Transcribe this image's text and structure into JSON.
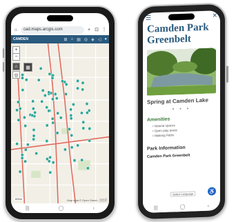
{
  "left_phone": {
    "status": {
      "time": "",
      "indicators": ""
    },
    "browser": {
      "home_icon": "home-icon",
      "url": "cad.maps.arcgis.com",
      "tab_count": "⊡",
      "add_tab": "+"
    },
    "map_app": {
      "brand": "CAMDEN",
      "tools": [
        "⊞",
        "⌂",
        "▤",
        "◎",
        "◈",
        "◁",
        "●"
      ],
      "scale_label": "600m",
      "attribution": "Map data © Open Street...",
      "esri_logo": "esri",
      "zoom_in": "+",
      "zoom_out": "−"
    },
    "nav": {
      "menu": "|||",
      "home": "◯",
      "back": "‹"
    }
  },
  "right_phone": {
    "menu_icon": "☰",
    "close_icon": "✕",
    "title": "Camden Park Greenbelt",
    "photo_caption": "Spring at Camden Lake",
    "carousel_dots": "● ● ●",
    "amenities": {
      "heading": "Amenities",
      "items": [
        "Natural spaces",
        "Open play areas",
        "Walking Paths"
      ]
    },
    "park_info": {
      "heading": "Park Information",
      "subheading": "Camden Park Greenbelt"
    },
    "language_button": "Select Language",
    "accessibility_icon": "accessibility-icon",
    "nav": {
      "menu": "|||",
      "home": "◯",
      "back": "‹"
    }
  },
  "colors": {
    "brand_blue": "#2a5a7e",
    "amenities_green": "#3a7a3a",
    "map_marker": "#2ea89a"
  }
}
